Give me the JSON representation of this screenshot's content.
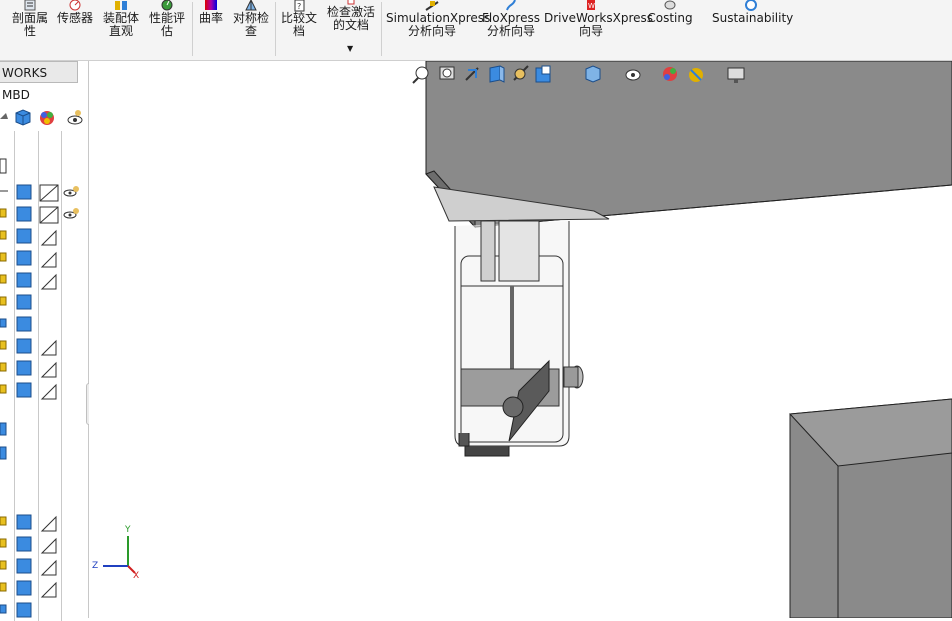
{
  "ribbon": {
    "buttons": [
      {
        "label1": "剖面属",
        "label2": "性",
        "icon": "section-properties-icon"
      },
      {
        "label1": "传感器",
        "label2": "",
        "icon": "sensor-icon"
      },
      {
        "label1": "装配体",
        "label2": "直观",
        "icon": "assembly-visualization-icon"
      },
      {
        "label1": "性能评",
        "label2": "估",
        "icon": "performance-evaluation-icon"
      },
      {
        "label1": "曲率",
        "label2": "",
        "icon": "curvature-icon"
      },
      {
        "label1": "对称检",
        "label2": "查",
        "icon": "symmetry-check-icon"
      },
      {
        "label1": "比较文",
        "label2": "档",
        "icon": "compare-documents-icon"
      },
      {
        "label1": "检查激活",
        "label2": "的文档",
        "icon": "check-active-document-icon"
      },
      {
        "label1": "SimulationXpress",
        "label2": "分析向导",
        "icon": "simulationxpress-icon"
      },
      {
        "label1": "FloXpress",
        "label2": "分析向导",
        "icon": "floxpress-icon"
      },
      {
        "label1": "DriveWorksXpress",
        "label2": "向导",
        "icon": "driveworksxpress-icon"
      },
      {
        "label1": "Costing",
        "label2": "",
        "icon": "costing-icon"
      },
      {
        "label1": "Sustainability",
        "label2": "",
        "icon": "sustainability-icon"
      }
    ]
  },
  "left_panel": {
    "tab_label": "WORKS MBD"
  },
  "viewport": {
    "triad": {
      "y": "Y",
      "z": "Z",
      "x": "X"
    }
  },
  "colors": {
    "model_gray": "#8a8a8a",
    "model_gray_top": "#9b9b9b",
    "accent_blue": "#2f7fd6"
  }
}
